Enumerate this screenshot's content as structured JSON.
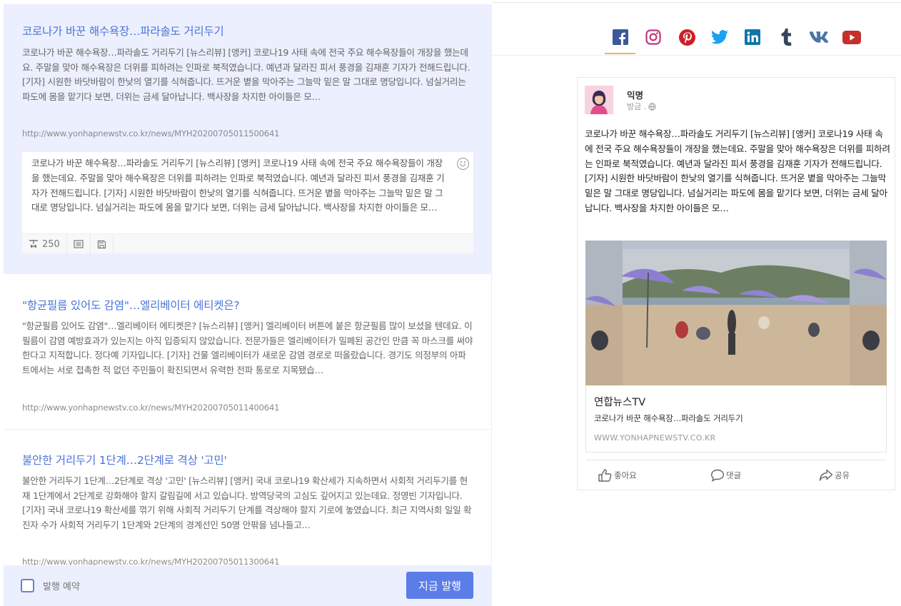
{
  "articles": [
    {
      "title": "코로나가 바꾼 해수욕장…파라솔도 거리두기",
      "body": "코로나가 바꾼 해수욕장…파라솔도 거리두기 [뉴스리뷰] [앵커] 코로나19 사태 속에 전국 주요 해수욕장들이 개장을 했는데요. 주말을 맞아 해수욕장은 더위를 피하려는 인파로 북적였습니다. 예년과 달라진 피서 풍경을 김재훈 기자가 전해드립니다. [기자] 시원한 바닷바람이 한낮의 열기를 식혀줍니다. 뜨거운 볕을 막아주는 그늘막 밑은 말 그대로 명당입니다. 넘실거리는 파도에 몸을 맡기다 보면, 더위는 금세 달아납니다. 백사장을 차지한 아이들은 모…",
      "url": "http://www.yonhapnewstv.co.kr/news/MYH20200705011500641"
    },
    {
      "title": "\"항균필름 있어도 감염\"…엘리베이터 에티켓은?",
      "body": "\"항균필름 있어도 감염\"…엘리베이터 에티켓은? [뉴스리뷰] [앵커] 엘리베이터 버튼에 붙은 항균필름 많이 보셨을 텐데요. 이 필름이 감염 예방효과가 있는지는 아직 입증되지 않았습니다. 전문가들은 엘리베이터가 밀폐된 공간인 만큼 꼭 마스크를 써야 한다고 지적합니다. 정다예 기자입니다. [기자] 건물 엘리베이터가 새로운 감염 경로로 떠올랐습니다. 경기도 의정부의 아파트에서는 서로 접촉한 적 없던 주민들이 확진되면서 유력한 전파 통로로 지목됐습…",
      "url": "http://www.yonhapnewstv.co.kr/news/MYH20200705011400641"
    },
    {
      "title": "불안한 거리두기 1단계…2단계로 격상 '고민'",
      "body": "불안한 거리두기 1단계…2단계로 격상 '고민' [뉴스리뷰] [앵커] 국내 코로나19 확산세가 지속하면서 사회적 거리두기를 현재 1단계에서 2단계로 강화해야 할지 갈림길에 서고 있습니다. 방역당국의 고심도 깊어지고 있는데요. 정영빈 기자입니다. [기자] 국내 코로나19 확산세를 꺾기 위해 사회적 거리두기 단계를 격상해야 할지 기로에 놓였습니다. 최근 지역사회 일일 확진자 수가 사회적 거리두기 1단계와 2단계의 경계선인 50명 안팎을 넘나들고…",
      "url": "http://www.yonhapnewstv.co.kr/news/MYH20200705011300641"
    }
  ],
  "editor": {
    "text": "코로나가 바꾼 해수욕장…파라솔도 거리두기 [뉴스리뷰] [앵커] 코로나19 사태 속에 전국 주요 해수욕장들이 개장을 했는데요. 주말을 맞아 해수욕장은 더위를 피하려는 인파로 북적였습니다. 예년과 달라진 피서 풍경을 김재훈 기자가 전해드립니다. [기자] 시원한 바닷바람이 한낮의 열기를 식혀줍니다. 뜨거운 볕을 막아주는 그늘막 밑은 말 그대로 명당입니다. 넘실거리는 파도에 몸을 맡기다 보면, 더위는 금세 달아납니다. 백사장을 차지한 아이들은 모…",
    "char_count": "250",
    "icons": [
      "text-length-icon",
      "list-icon",
      "save-icon",
      "emoji-icon"
    ]
  },
  "footer": {
    "schedule_label": "발행 예약",
    "publish_label": "지금 발행"
  },
  "social_tabs": [
    {
      "name": "facebook",
      "icon": "facebook-icon",
      "color": "#3b5998",
      "active": true
    },
    {
      "name": "instagram",
      "icon": "instagram-icon",
      "color": "#c13584"
    },
    {
      "name": "pinterest",
      "icon": "pinterest-icon",
      "color": "#cb2027"
    },
    {
      "name": "twitter",
      "icon": "twitter-icon",
      "color": "#1da1f2"
    },
    {
      "name": "linkedin",
      "icon": "linkedin-icon",
      "color": "#0e76a8"
    },
    {
      "name": "tumblr",
      "icon": "tumblr-icon",
      "color": "#35465c"
    },
    {
      "name": "vk",
      "icon": "vk-icon",
      "color": "#4a76a8"
    },
    {
      "name": "youtube",
      "icon": "youtube-icon",
      "color": "#c4302b"
    }
  ],
  "preview": {
    "author": "익명",
    "meta": "방금 .",
    "text": "코로나가 바꾼 해수욕장…파라솔도 거리두기 [뉴스리뷰] [앵커] 코로나19 사태 속에 전국 주요 해수욕장들이 개장을 했는데요. 주말을 맞아 해수욕장은 더위를 피하려는 인파로 북적였습니다. 예년과 달라진 피서 풍경을 김재훈 기자가 전해드립니다. [기자] 시원한 바닷바람이 한낮의 열기를 식혀줍니다. 뜨거운 볕을 막아주는 그늘막 밑은 말 그대로 명당입니다. 넘실거리는 파도에 몸을 맡기다 보면, 더위는 금세 달아납니다. 백사장을 차지한 아이들은 모…",
    "link": {
      "site": "연합뉴스TV",
      "title": "코로나가 바꾼 해수욕장…파라솔도 거리두기",
      "domain": "WWW.YONHAPNEWSTV.CO.KR"
    },
    "actions": {
      "like": "좋아요",
      "comment": "댓글",
      "share": "공유"
    }
  }
}
